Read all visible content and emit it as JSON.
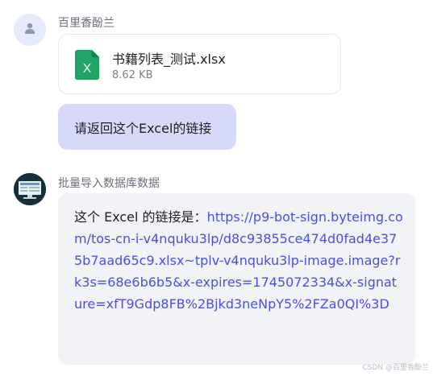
{
  "user_message": {
    "sender": "百里香酚兰",
    "avatar_icon": "person-icon",
    "file": {
      "icon": "excel-file-icon",
      "icon_letter": "X",
      "name": "书籍列表_测试.xlsx",
      "size": "8.62 KB",
      "icon_color": "#21a366"
    },
    "text": "请返回这个Excel的链接",
    "bubble_color": "#d7d9fb"
  },
  "bot_message": {
    "sender": "批量导入数据库数据",
    "avatar_icon": "bot-avatar-icon",
    "text_prefix": "这个 Excel 的链接是：",
    "link": "https://p9-bot-sign.byteimg.com/tos-cn-i-v4nquku3lp/d8c93855ce474d0fad4e375b7aad65c9.xlsx~tplv-v4nquku3lp-image.image?rk3s=68e6b6b5&x-expires=1745072334&x-signature=xfT9Gdp8FB%2Bjkd3neNpY5%2FZa0QI%3D",
    "link_color": "#4b4fe0",
    "bubble_color": "#f2f3f7"
  },
  "watermark": "CSDN @百里香酚兰"
}
